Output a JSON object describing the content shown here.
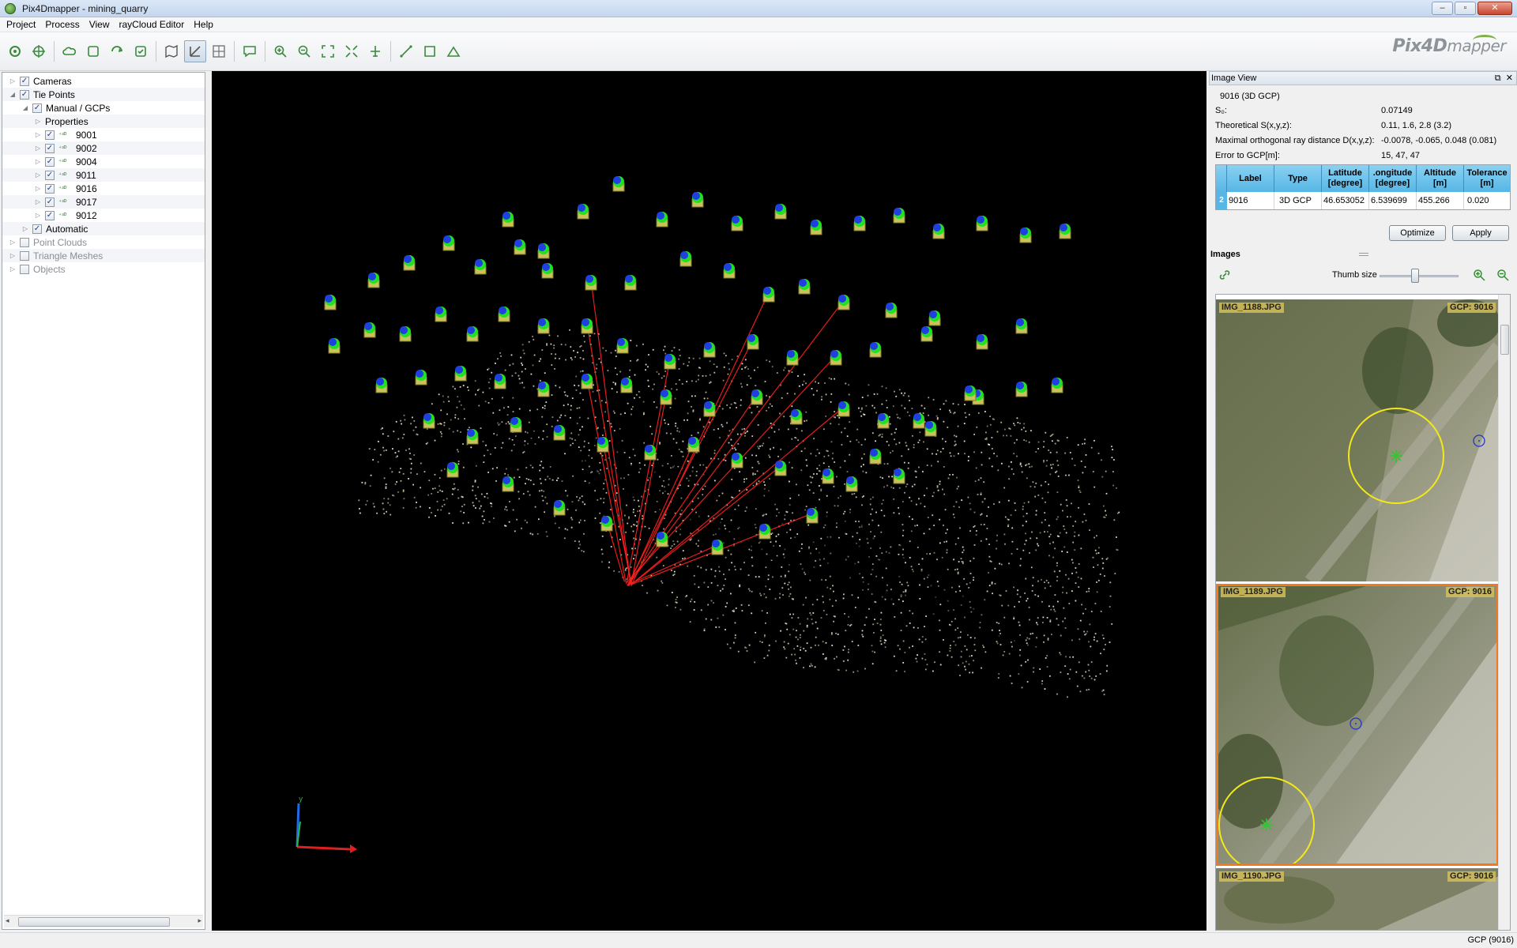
{
  "window": {
    "title": "Pix4Dmapper - mining_quarry",
    "brand": "Pix4D",
    "brand_suffix": "mapper"
  },
  "menu": [
    "Project",
    "Process",
    "View",
    "rayCloud Editor",
    "Help"
  ],
  "toolbar": {
    "buttons": [
      "project-icon",
      "gcp-manager-icon",
      "cloud-icon",
      "step1-icon",
      "step2-icon",
      "step3-icon",
      "map-view-icon",
      "raycloud-icon",
      "mosaic-editor-icon",
      "comment-icon",
      "zoom-in-icon",
      "zoom-out-icon",
      "zoom-extent-icon",
      "fit-icon",
      "flight-icon",
      "measure-line-icon",
      "measure-surface-icon",
      "volume-icon"
    ],
    "active": "raycloud-icon"
  },
  "tree": {
    "items": [
      {
        "label": "Cameras",
        "level": 0,
        "checked": true,
        "expanded": false
      },
      {
        "label": "Tie Points",
        "level": 0,
        "checked": true,
        "expanded": true
      },
      {
        "label": "Manual / GCPs",
        "level": 1,
        "checked": true,
        "expanded": true
      },
      {
        "label": "Properties",
        "level": 2,
        "checked": null,
        "expanded": false
      },
      {
        "label": "9001",
        "level": 2,
        "checked": true,
        "gcp": true
      },
      {
        "label": "9002",
        "level": 2,
        "checked": true,
        "gcp": true
      },
      {
        "label": "9004",
        "level": 2,
        "checked": true,
        "gcp": true
      },
      {
        "label": "9011",
        "level": 2,
        "checked": true,
        "gcp": true
      },
      {
        "label": "9016",
        "level": 2,
        "checked": true,
        "gcp": true
      },
      {
        "label": "9017",
        "level": 2,
        "checked": true,
        "gcp": true
      },
      {
        "label": "9012",
        "level": 2,
        "checked": true,
        "gcp": true
      },
      {
        "label": "Automatic",
        "level": 1,
        "checked": true,
        "expanded": false
      },
      {
        "label": "Point Clouds",
        "level": 0,
        "checked": false,
        "grey": true
      },
      {
        "label": "Triangle Meshes",
        "level": 0,
        "checked": false,
        "grey": true
      },
      {
        "label": "Objects",
        "level": 0,
        "checked": false,
        "grey": true
      }
    ]
  },
  "image_view": {
    "header": "Image View",
    "selection": "9016 (3D GCP)",
    "stats": [
      {
        "label": "S₀:",
        "value": "0.07149"
      },
      {
        "label": "Theoretical S(x,y,z):",
        "value": "0.11, 1.6, 2.8 (3.2)"
      },
      {
        "label": "Maximal orthogonal ray distance D(x,y,z):",
        "value": "-0.0078, -0.065, 0.048 (0.081)"
      },
      {
        "label": "Error to GCP[m]:",
        "value": "15, 47, 47"
      }
    ],
    "table": {
      "headers": [
        "Label",
        "Type",
        "Latitude [degree]",
        ".ongitude [degree]",
        "Altitude [m]",
        "Tolerance [m]"
      ],
      "row_number": "2",
      "row": [
        "9016",
        "3D GCP",
        "46.653052",
        "6.539699",
        "455.266",
        "0.020"
      ]
    },
    "optimize_label": "Optimize",
    "apply_label": "Apply"
  },
  "images": {
    "header": "Images",
    "thumb_size_label": "Thumb size",
    "thumb_size": 0.45,
    "items": [
      {
        "name": "IMG_1188.JPG",
        "gcp": "GCP: 9016",
        "selected": false
      },
      {
        "name": "IMG_1189.JPG",
        "gcp": "GCP: 9016",
        "selected": true
      },
      {
        "name": "IMG_1190.JPG",
        "gcp": "GCP: 9016",
        "selected": false
      }
    ]
  },
  "status": {
    "text": "GCP (9016)"
  },
  "colors": {
    "ray": "#ff2020",
    "camera_green": "#22e022",
    "camera_blue": "#1f3fe0",
    "accent_selected": "#f07a22",
    "mark_circle": "#f2e81a"
  }
}
